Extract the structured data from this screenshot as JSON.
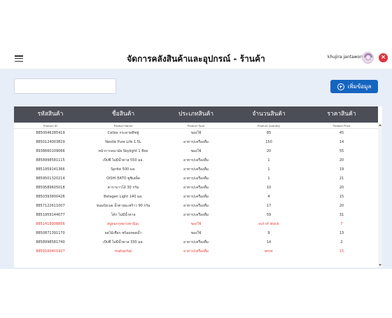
{
  "header": {
    "title": "จัดการคลังสินค้าและอุปกรณ์ - ร้านค้า",
    "user_name": "khujira jantawong",
    "menu_icon": "hamburger-icon",
    "close_icon": "close-icon"
  },
  "toolbar": {
    "search_value": "",
    "search_placeholder": "",
    "add_label": "เพิ่มข้อมูล"
  },
  "table": {
    "columns": [
      {
        "label": "รหัสสินค้า",
        "sub": "Product ID"
      },
      {
        "label": "ชื่อสินค้า",
        "sub": "Product Name"
      },
      {
        "label": "ประเภทสินค้า",
        "sub": "Product Type"
      },
      {
        "label": "จำนวนสินค้า",
        "sub": "Product Quantity"
      },
      {
        "label": "ราคาสินค้า",
        "sub": "Product Price"
      }
    ],
    "rows": [
      {
        "id": "8850046285419",
        "name": "Cellox กระดาษทิชชู่",
        "type": "ของใช้",
        "qty": "85",
        "price": "45",
        "red": false
      },
      {
        "id": "8850124003829",
        "name": "Nestle Pure Life 1.5L",
        "type": "อาหาร/เครื่องดื่ม",
        "qty": "150",
        "price": "14",
        "red": false
      },
      {
        "id": "8938660109066",
        "name": "หน้ากากอนามัย Skylight 1 Box",
        "type": "ของใช้",
        "qty": "20",
        "price": "55",
        "red": false
      },
      {
        "id": "8858998581115",
        "name": "เป๊ปซี่ ไม่มีน้ำตาล 550 มล.",
        "type": "อาหาร/เครื่องดื่ม",
        "qty": "1",
        "price": "20",
        "red": false
      },
      {
        "id": "8851959141366",
        "name": "Sprite 500 มล.",
        "type": "อาหาร/เครื่องดื่ม",
        "qty": "1",
        "price": "19",
        "red": false
      },
      {
        "id": "8859501320214",
        "name": "OISHI EATO ซูชิเสล็ด",
        "type": "อาหาร/เครื่องดื่ม",
        "qty": "1",
        "price": "21",
        "red": false
      },
      {
        "id": "8859589605018",
        "name": "คาราบาวโอ้ 30 กรัม",
        "type": "อาหาร/เครื่องดื่ม",
        "qty": "10",
        "price": "20",
        "red": false
      },
      {
        "id": "8850393800426",
        "name": "Betagen Light 140 มล.",
        "type": "อาหาร/เครื่องดื่ม",
        "qty": "4",
        "price": "15",
        "red": false
      },
      {
        "id": "8857122611007",
        "name": "ขนมปังเนย น้ำตาลมะพร้าว 90 กรัม",
        "type": "อาหาร/เครื่องดื่ม",
        "qty": "17",
        "price": "20",
        "red": false
      },
      {
        "id": "8851959144077",
        "name": "โค้ก ไม่มีน้ำตาล",
        "type": "อาหาร/เครื่องดื่ม",
        "qty": "59",
        "price": "31",
        "red": false
      },
      {
        "id": "8851419008856",
        "name": "สบู่ดอกกุหลาบทานิอะ",
        "type": "ของใช้",
        "qty": "out of stock",
        "price": "7",
        "red": true
      },
      {
        "id": "8850871391170",
        "name": "ผลไม้เชือก พร้อมทอดน้ำ",
        "type": "ของใช้",
        "qty": "9",
        "price": "13",
        "red": false
      },
      {
        "id": "8858998581740",
        "name": "เป๊ปซี่ ไม่มีน้ำตาล 330 มล.",
        "type": "อาหาร/เครื่องดื่ม",
        "qty": "14",
        "price": "2",
        "red": false
      },
      {
        "id": "8859160401927",
        "name": "mahachai",
        "type": "อาหาร/เครื่องดื่ม",
        "qty": "error",
        "price": "15",
        "red": true
      }
    ]
  },
  "colors": {
    "header_bg": "#4b4e57",
    "accent": "#1565c0",
    "error": "#e53935",
    "content_bg": "#e8eef8"
  }
}
